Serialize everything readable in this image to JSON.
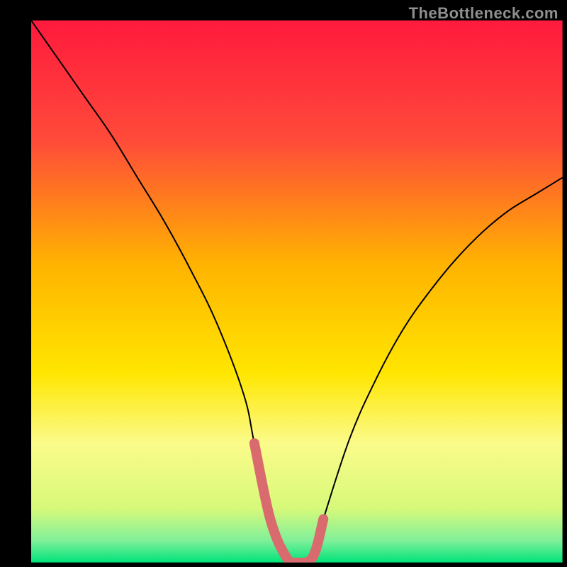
{
  "watermark": "TheBottleneck.com",
  "colors": {
    "black": "#000000",
    "curve": "#000000",
    "highlight": "#d96a6d",
    "green": "#00e37a"
  },
  "chart_data": {
    "type": "line",
    "title": "",
    "xlabel": "",
    "ylabel": "",
    "xlim": [
      0,
      100
    ],
    "ylim": [
      0,
      100
    ],
    "series": [
      {
        "name": "bottleneck-curve",
        "x": [
          0,
          5,
          10,
          15,
          20,
          25,
          30,
          35,
          40,
          42,
          45,
          48,
          50,
          53,
          55,
          60,
          65,
          70,
          75,
          80,
          85,
          90,
          95,
          100
        ],
        "values": [
          100,
          93,
          86,
          79,
          71,
          63,
          54,
          44,
          31,
          22,
          8,
          1,
          0,
          1,
          8,
          23,
          34,
          43,
          50,
          56,
          61,
          65,
          68,
          71
        ]
      },
      {
        "name": "valley-highlight",
        "x": [
          42,
          45,
          48,
          50,
          53,
          55
        ],
        "values": [
          22,
          8,
          1,
          0,
          1,
          8
        ]
      }
    ],
    "gradient_stops": [
      {
        "pct": 0,
        "color": "#ff1a3d"
      },
      {
        "pct": 22,
        "color": "#ff4a3a"
      },
      {
        "pct": 45,
        "color": "#ffb300"
      },
      {
        "pct": 65,
        "color": "#ffe600"
      },
      {
        "pct": 78,
        "color": "#fbfb8a"
      },
      {
        "pct": 90,
        "color": "#d7f97a"
      },
      {
        "pct": 96,
        "color": "#7ff09a"
      },
      {
        "pct": 100,
        "color": "#00e37a"
      }
    ],
    "inner_box": {
      "left_pct": 5.5,
      "top_pct": 3.6,
      "right_pct": 99.2,
      "bottom_pct": 99.2
    }
  }
}
